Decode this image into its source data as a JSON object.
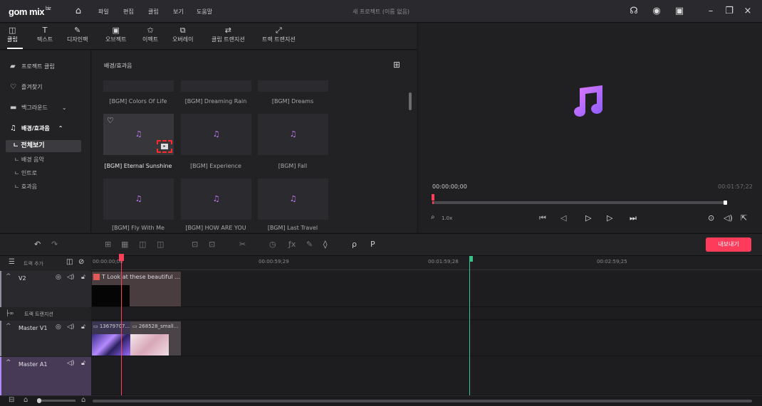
{
  "app": {
    "logo": "gom mix",
    "logo_badge": "biz",
    "document_title": "새 프로젝트 (이름 없음)",
    "menu": [
      "파일",
      "편집",
      "클립",
      "보기",
      "도움말"
    ]
  },
  "tabs": [
    {
      "label": "클립",
      "icon": "clip-icon",
      "active": true
    },
    {
      "label": "텍스트",
      "icon": "text-icon"
    },
    {
      "label": "디자인팩",
      "icon": "design-pack-icon"
    },
    {
      "label": "오브젝트",
      "icon": "object-icon"
    },
    {
      "label": "이펙트",
      "icon": "effect-icon"
    },
    {
      "label": "오버레이",
      "icon": "overlay-icon"
    },
    {
      "label": "클립 트랜지션",
      "icon": "clip-transition-icon"
    },
    {
      "label": "트랙 트랜지션",
      "icon": "track-transition-icon"
    }
  ],
  "sidebar": {
    "items": [
      {
        "label": "프로젝트 클립",
        "icon": "folder-icon"
      },
      {
        "label": "즐겨찾기",
        "icon": "heart-icon"
      },
      {
        "label": "백그라운드",
        "icon": "image-icon"
      },
      {
        "label": "배경/효과음",
        "icon": "music-icon"
      }
    ],
    "sub_items": [
      "전체보기",
      "배경 음악",
      "인트로",
      "효과음"
    ]
  },
  "library": {
    "heading": "배경/효과음",
    "row0": [
      "[BGM] Colors Of Life",
      "[BGM] Dreaming Rain",
      "[BGM] Dreams"
    ],
    "row1": [
      "[BGM] Eternal Sunshine",
      "[BGM] Experience",
      "[BGM] Fall"
    ],
    "row2": [
      "[BGM] Fly With Me",
      "[BGM] HOW ARE YOU",
      "[BGM] Last Travel"
    ]
  },
  "preview": {
    "current_time": "00:00:00;00",
    "total_time": "00:01:57;22",
    "zoom": "1.0x",
    "progress": 0.0
  },
  "toolbar": {
    "export_label": "내보내기"
  },
  "timeline": {
    "add_track_label": "트랙 추가",
    "ruler": [
      "00:00:00;00",
      "00:00:59;29",
      "00:01:59;28",
      "00:02:59;25"
    ],
    "tracks": [
      {
        "name": "V2",
        "clip_label": "Look at these beautiful ..."
      },
      {
        "name": "트랙 트랜지션"
      },
      {
        "name": "Master V1",
        "clip_a": "13679707...",
        "clip_b": "268528_small..."
      },
      {
        "name": "Master A1"
      }
    ]
  },
  "colors": {
    "accent": "#ff3b5c",
    "note": "#c77dff",
    "end_marker": "#37c28a"
  }
}
